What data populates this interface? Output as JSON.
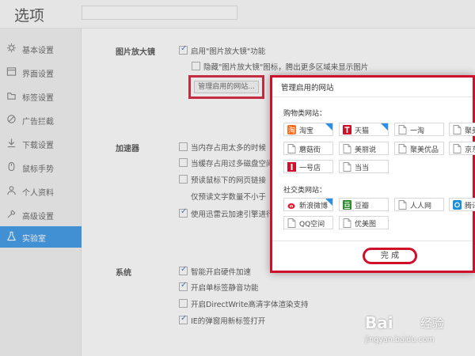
{
  "app": {
    "title": "选项"
  },
  "sidebar": {
    "items": [
      {
        "label": "基本设置",
        "icon": "gear-icon"
      },
      {
        "label": "界面设置",
        "icon": "window-icon"
      },
      {
        "label": "标签设置",
        "icon": "tab-icon"
      },
      {
        "label": "广告拦截",
        "icon": "block-icon"
      },
      {
        "label": "下载设置",
        "icon": "download-icon"
      },
      {
        "label": "鼠标手势",
        "icon": "mouse-icon"
      },
      {
        "label": "个人资料",
        "icon": "person-icon"
      },
      {
        "label": "高级设置",
        "icon": "tools-icon"
      },
      {
        "label": "实验室",
        "icon": "flask-icon",
        "active": true
      }
    ]
  },
  "main": {
    "magnifier": {
      "title": "图片放大镜",
      "enable": "启用\"图片放大镜\"功能",
      "hide_icon": "隐藏\"图片放大镜\"图标，腾出更多区域来显示图片",
      "manage_button": "管理启用的网站..."
    },
    "accelerator": {
      "title": "加速器",
      "items": [
        {
          "label": "当内存占用太多的时候",
          "checked": false
        },
        {
          "label": "当缓存占用过多磁盘空间",
          "checked": false
        },
        {
          "label": "预读鼠标下的网页链接",
          "checked": false
        },
        {
          "label": "仅预读文字数量不小于",
          "checked": null
        },
        {
          "label": "使用迅雷云加速引擎进行",
          "checked": true
        }
      ]
    },
    "system": {
      "title": "系统",
      "items": [
        {
          "label": "智能开启硬件加速",
          "checked": true
        },
        {
          "label": "开启单标签静音功能",
          "checked": true
        },
        {
          "label": "开启DirectWrite高清字体渲染支持",
          "checked": false
        },
        {
          "label": "IE的弹窗用新标签打开",
          "checked": true
        }
      ]
    }
  },
  "dialog": {
    "title": "管理启用的网站",
    "shopping": {
      "title": "购物类网站：",
      "sites": [
        {
          "name": "淘宝",
          "icon": "taobao-icon",
          "enabled": true
        },
        {
          "name": "天猫",
          "icon": "tmall-icon",
          "enabled": true
        },
        {
          "name": "一淘",
          "icon": "page-icon",
          "enabled": false
        },
        {
          "name": "聚美",
          "icon": "page-icon",
          "enabled": false
        },
        {
          "name": "蘑菇街",
          "icon": "page-icon",
          "enabled": false
        },
        {
          "name": "美丽说",
          "icon": "page-icon",
          "enabled": false
        },
        {
          "name": "聚美优品",
          "icon": "page-icon",
          "enabled": false
        },
        {
          "name": "京东商",
          "icon": "page-icon",
          "enabled": false
        },
        {
          "name": "一号店",
          "icon": "yhd-icon",
          "enabled": false
        },
        {
          "name": "当当",
          "icon": "page-icon",
          "enabled": false
        }
      ]
    },
    "social": {
      "title": "社交类网站：",
      "sites": [
        {
          "name": "新浪微博",
          "icon": "weibo-icon",
          "enabled": true
        },
        {
          "name": "豆瓣",
          "icon": "douban-icon",
          "enabled": false
        },
        {
          "name": "人人网",
          "icon": "page-icon",
          "enabled": false
        },
        {
          "name": "腾讯",
          "icon": "tencent-icon",
          "enabled": false
        },
        {
          "name": "QQ空间",
          "icon": "page-icon",
          "enabled": false
        },
        {
          "name": "优美图",
          "icon": "page-icon",
          "enabled": false
        }
      ]
    },
    "done_button": "完 成"
  },
  "watermark": {
    "logo": "Bai",
    "text": "经验",
    "url": "jingyan.baidu.com"
  },
  "colors": {
    "accent": "#2b8fe6",
    "highlight": "#d0102a"
  }
}
